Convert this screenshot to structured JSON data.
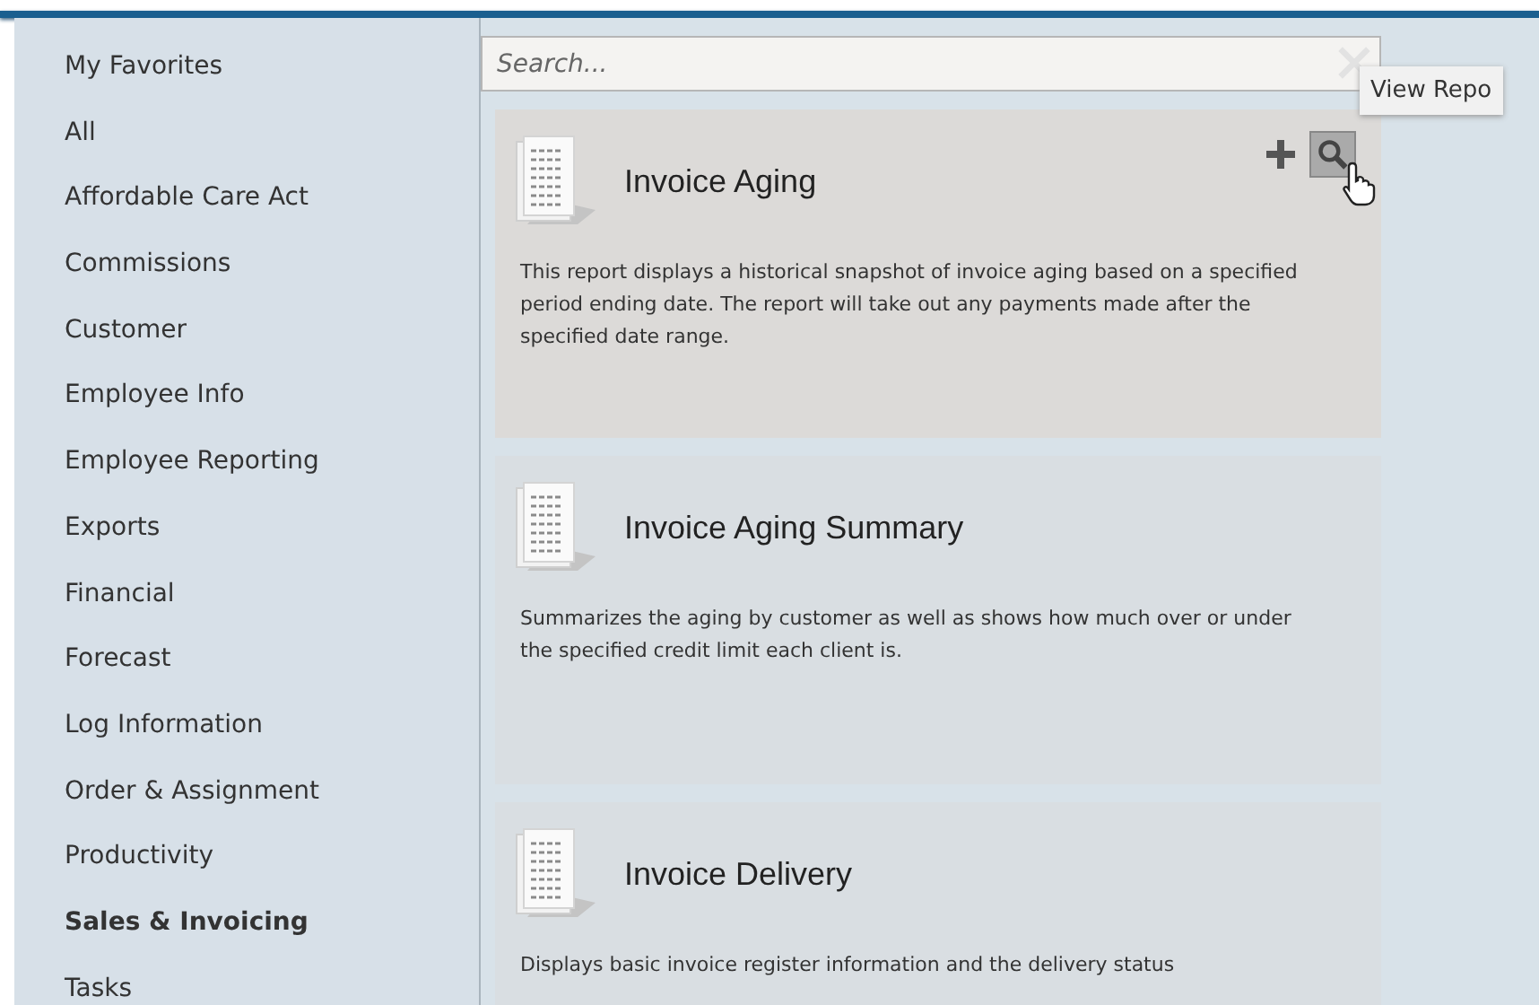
{
  "sidebar": {
    "items": [
      {
        "label": "My Favorites",
        "selected": false
      },
      {
        "label": "All",
        "selected": false
      },
      {
        "label": "Affordable Care Act",
        "selected": false
      },
      {
        "label": "Commissions",
        "selected": false
      },
      {
        "label": "Customer",
        "selected": false
      },
      {
        "label": "Employee Info",
        "selected": false
      },
      {
        "label": "Employee Reporting",
        "selected": false
      },
      {
        "label": "Exports",
        "selected": false
      },
      {
        "label": "Financial",
        "selected": false
      },
      {
        "label": "Forecast",
        "selected": false
      },
      {
        "label": "Log Information",
        "selected": false
      },
      {
        "label": "Order & Assignment",
        "selected": false
      },
      {
        "label": "Productivity",
        "selected": false
      },
      {
        "label": "Sales & Invoicing",
        "selected": true
      },
      {
        "label": "Tasks",
        "selected": false
      }
    ]
  },
  "search": {
    "placeholder": "Search..."
  },
  "tooltip": "View Repo",
  "reports": [
    {
      "title": "Invoice Aging",
      "description": "This report displays a historical snapshot of invoice aging based on a specified period ending date.  The report will take out any payments made after the specified date range.",
      "hovered": true
    },
    {
      "title": "Invoice Aging Summary",
      "description": "Summarizes the aging by customer as well as shows how much over or under the specified credit limit each client is.",
      "hovered": false
    },
    {
      "title": "Invoice Delivery",
      "description": "Displays basic invoice register information and the delivery status",
      "hovered": false
    }
  ]
}
